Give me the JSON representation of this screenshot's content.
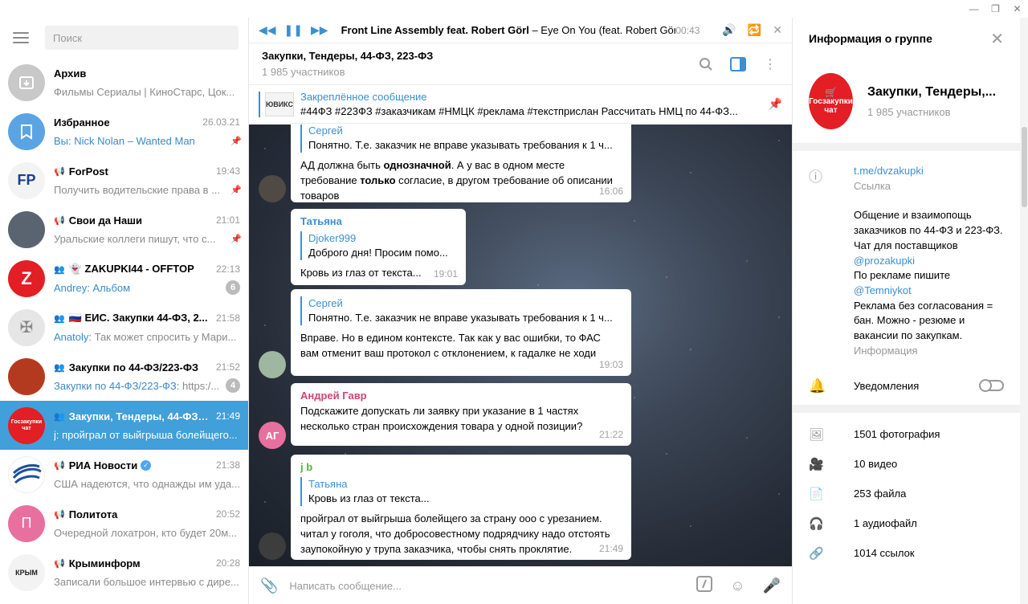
{
  "search": {
    "placeholder": "Поиск"
  },
  "chats": [
    {
      "name": "Архив",
      "time": "",
      "preview": "Фильмы Сериалы | КиноСтарс, Цок...",
      "preview_hl": "",
      "badge": "",
      "pinned": false,
      "avatar_color": "#c8c8c8",
      "avatar_text": ""
    },
    {
      "name": "Избранное",
      "time": "26.03.21",
      "preview": "Nick Nolan – Wanted Man",
      "preview_hl": "Вы: ",
      "badge": "",
      "pinned": true,
      "avatar_color": "#5aa4e3",
      "avatar_text": ""
    },
    {
      "name": "ForPost",
      "time": "19:43",
      "preview": "Получить водительские права в ...",
      "preview_hl": "",
      "badge": "",
      "pinned": true,
      "avatar_color": "#f3f3f3",
      "avatar_text": "FP"
    },
    {
      "name": "Свои да Наши",
      "time": "21:01",
      "preview": "Уральские коллеги пишут, что с...",
      "preview_hl": "",
      "badge": "",
      "pinned": true,
      "avatar_color": "#5a6470",
      "avatar_text": ""
    },
    {
      "name": "👻 ZAKUPKI44 - OFFTOP",
      "time": "22:13",
      "preview": "Альбом",
      "preview_hl": "Andrey: ",
      "badge": "6",
      "pinned": false,
      "avatar_color": "#e31e24",
      "avatar_text": "Z"
    },
    {
      "name": "🇷🇺 ЕИС. Закупки 44-ФЗ, 2...",
      "time": "21:58",
      "preview": "Так может спросить у Мари...",
      "preview_hl": "Anatoly: ",
      "badge": "",
      "pinned": false,
      "avatar_color": "#e6e6e6",
      "avatar_text": ""
    },
    {
      "name": "Закупки по 44-ФЗ/223-ФЗ",
      "time": "21:52",
      "preview": "https:/...",
      "preview_hl": "Закупки по 44-ФЗ/223-ФЗ: ",
      "badge": "4",
      "pinned": false,
      "avatar_color": "#b33a1e",
      "avatar_text": ""
    },
    {
      "name": "Закупки, Тендеры, 44-ФЗ, ...",
      "time": "21:49",
      "preview": "j: пройграл от выйгрыша болейщего...",
      "preview_hl": "",
      "badge": "",
      "pinned": false,
      "avatar_color": "#e31e24",
      "avatar_text": ""
    },
    {
      "name": "РИА Новости",
      "time": "21:38",
      "preview": "США надеются, что однажды им уда...",
      "preview_hl": "",
      "badge": "",
      "pinned": false,
      "avatar_color": "#ffffff",
      "avatar_text": ""
    },
    {
      "name": "Политота",
      "time": "20:52",
      "preview": "Очередной лохатрон, кто будет 20м...",
      "preview_hl": "",
      "badge": "",
      "pinned": false,
      "avatar_color": "#e8709f",
      "avatar_text": "П"
    },
    {
      "name": "Крыминформ",
      "time": "20:28",
      "preview": "Записали большое интервью с дире...",
      "preview_hl": "",
      "badge": "",
      "pinned": false,
      "avatar_color": "#f3f3f3",
      "avatar_text": "КРЫМ"
    }
  ],
  "player": {
    "artist": "Front Line Assembly feat. Robert Görl",
    "track": " – Eye On You (feat. Robert Görl)",
    "time": "00:43"
  },
  "chat_header": {
    "title": "Закупки, Тендеры, 44-ФЗ, 223-ФЗ",
    "members": "1 985 участников"
  },
  "pinned": {
    "title": "Закреплённое сообщение",
    "thumb": "ЮВИКС",
    "body": "#44ФЗ #223ФЗ #заказчикам #НМЦК #реклама #текстприслан   Рассчитать НМЦ по 44-ФЗ..."
  },
  "messages": [
    {
      "sender": "",
      "reply_name": "Сергей",
      "reply_text": "Понятно. Т.е. заказчик не вправе указывать требования к 1 ч...",
      "text_parts": [
        "АД должна быть ",
        "однозначной",
        ". А у вас в одном месте требование ",
        "только",
        " согласие, в другом требование об описании товаров"
      ],
      "time": "16:06"
    },
    {
      "sender": "Татьяна",
      "reply_name": "Djoker999",
      "reply_text": "Доброго дня! Просим помо...",
      "text": "Кровь из глаз от текста...",
      "time": "19:01"
    },
    {
      "sender": "",
      "reply_name": "Сергей",
      "reply_text": "Понятно. Т.е. заказчик не вправе указывать требования к 1 ч...",
      "text": "Вправе. Но в едином контексте. Так как у вас ошибки, то ФАС вам отменит ваш протокол с отклонением, к гадалке не ходи",
      "time": "19:03"
    },
    {
      "sender": "Андрей Гавр",
      "text": "Подскажите допускать ли заявку при указание в 1 частях несколько стран происхождения товара у одной позиции?",
      "time": "21:22",
      "avatar_text": "АГ"
    },
    {
      "sender": "j b",
      "reply_name": "Татьяна",
      "reply_text": "Кровь из глаз от текста...",
      "text": "пройграл от выйгрыша болейщего за страну ооо с урезанием. читал у гоголя, что добросовестному подрядчику надо отстоять заупокойную у трупа заказчика, чтобы снять проклятие.",
      "time": "21:49"
    }
  ],
  "composer": {
    "placeholder": "Написать сообщение..."
  },
  "info": {
    "title": "Информация о группе",
    "group_name": "Закупки, Тендеры,...",
    "members": "1 985 участников",
    "avatar_line1": "Госзакупки",
    "avatar_line2": "чат",
    "link": "t.me/dvzakupki",
    "link_label": "Ссылка",
    "desc_1": "Общение и взаимопощь заказчиков по 44-ФЗ и 223-ФЗ. Чат для поставщиков ",
    "desc_link1": "@prozakupki",
    "desc_2": "По рекламе пишите ",
    "desc_link2": "@Temniykot",
    "desc_3": "Реклама без согласования = бан. Можно - резюме и вакансии по закупкам.",
    "desc_label": "Информация",
    "notify_label": "Уведомления",
    "media": [
      {
        "icon": "photo-icon",
        "label": "1501 фотография"
      },
      {
        "icon": "video-icon",
        "label": "10 видео"
      },
      {
        "icon": "file-icon",
        "label": "253 файла"
      },
      {
        "icon": "audio-icon",
        "label": "1 аудиофайл"
      },
      {
        "icon": "link-icon",
        "label": "1014 ссылок"
      }
    ]
  }
}
